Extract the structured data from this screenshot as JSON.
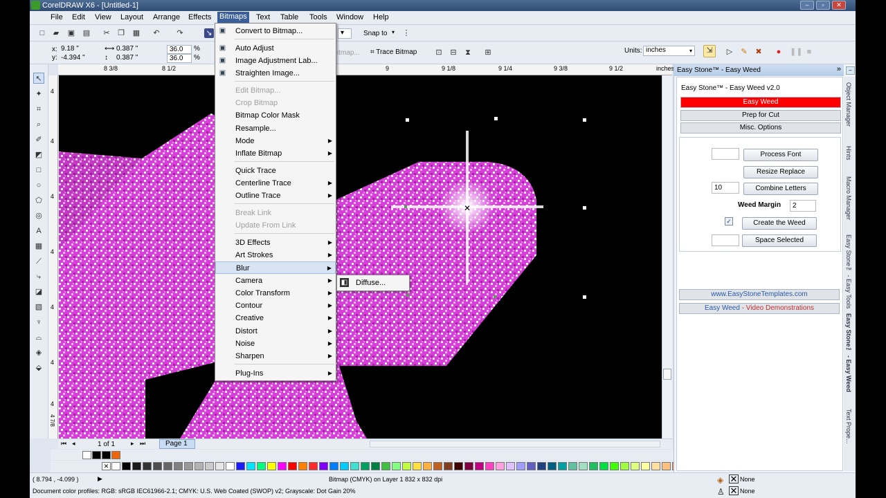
{
  "window": {
    "title": "CorelDRAW X6 - [Untitled-1]"
  },
  "menubar": [
    "File",
    "Edit",
    "View",
    "Layout",
    "Arrange",
    "Effects",
    "Bitmaps",
    "Text",
    "Table",
    "Tools",
    "Window",
    "Help"
  ],
  "toolbar1": {
    "snap_label": "Snap to"
  },
  "toolbar2": {
    "x": "9.18 \"",
    "y": "-4.394 \"",
    "w": "0.387 \"",
    "h": "0.387 \"",
    "sx": "36.0",
    "sy": "36.0",
    "pct1": "%",
    "pct2": "%",
    "edit_bitmap_label": "itmap...",
    "trace_bitmap_label": "Trace Bitmap",
    "units_label": "Units:",
    "units_value": "inches"
  },
  "ruler": {
    "h_ticks": [
      "8 3/8",
      "8 1/2",
      "9",
      "9 1/8",
      "9 1/4",
      "9 3/8",
      "9 1/2",
      "inches"
    ],
    "v_ticks": [
      "4",
      "4",
      "4",
      "4",
      "4",
      "4",
      "4",
      "4 7/8",
      "inches"
    ]
  },
  "bitmaps_menu": [
    {
      "label": "Convert to Bitmap...",
      "icon": "convert-icon"
    },
    {
      "label": "Auto Adjust",
      "icon": "auto-adjust-icon"
    },
    {
      "label": "Image Adjustment Lab...",
      "icon": "image-lab-icon"
    },
    {
      "label": "Straighten Image...",
      "icon": "straighten-icon"
    },
    {
      "label": "Edit Bitmap...",
      "disabled": true
    },
    {
      "label": "Crop Bitmap",
      "disabled": true
    },
    {
      "label": "Bitmap Color Mask"
    },
    {
      "label": "Resample..."
    },
    {
      "label": "Mode",
      "submenu": true
    },
    {
      "label": "Inflate Bitmap",
      "submenu": true
    },
    {
      "label": "Quick Trace"
    },
    {
      "label": "Centerline Trace",
      "submenu": true
    },
    {
      "label": "Outline Trace",
      "submenu": true
    },
    {
      "label": "Break Link",
      "disabled": true
    },
    {
      "label": "Update From Link",
      "disabled": true
    },
    {
      "label": "3D Effects",
      "submenu": true
    },
    {
      "label": "Art Strokes",
      "submenu": true
    },
    {
      "label": "Blur",
      "submenu": true,
      "highlighted": true
    },
    {
      "label": "Camera",
      "submenu": true
    },
    {
      "label": "Color Transform",
      "submenu": true
    },
    {
      "label": "Contour",
      "submenu": true
    },
    {
      "label": "Creative",
      "submenu": true
    },
    {
      "label": "Distort",
      "submenu": true
    },
    {
      "label": "Noise",
      "submenu": true
    },
    {
      "label": "Sharpen",
      "submenu": true
    },
    {
      "label": "Plug-Ins",
      "submenu": true
    }
  ],
  "blur_submenu": {
    "label": "Diffuse..."
  },
  "docker": {
    "title": "Easy Stone™ - Easy Weed",
    "header": "Easy Stone™ - Easy Weed v2.0",
    "bar_easy_weed": "Easy Weed",
    "bar_prep": "Prep for Cut",
    "bar_misc": "Misc. Options",
    "process_font": "Process Font",
    "resize_replace": "Resize Replace",
    "combine_input": "10",
    "combine_letters": "Combine Letters",
    "weed_margin_label": "Weed Margin",
    "weed_margin_value": "2",
    "create_weed": "Create the Weed",
    "space_selected": "Space Selected",
    "link1": "www.EasyStoneTemplates.com",
    "link2_a": "Easy Weed",
    "link2_b": " - Video Demonstrations",
    "accent": "#ff0000"
  },
  "vtabs": [
    "Object Manager",
    "Hints",
    "Macro Manager",
    "Easy Stone™ - Easy Tools",
    "Easy Stone™ - Easy Weed",
    "Text Prope..."
  ],
  "pagebar": {
    "count": "1 of 1",
    "page_tab": "Page 1"
  },
  "status": {
    "coords": "( 8.794 , -4.099 )",
    "info": "Bitmap (CMYK) on Layer 1 832 x 832 dpi",
    "profiles": "Document color profiles: RGB: sRGB IEC61966-2.1; CMYK: U.S. Web Coated (SWOP) v2; Grayscale: Dot Gain 20%",
    "fill_none": "None",
    "outline_none": "None"
  }
}
